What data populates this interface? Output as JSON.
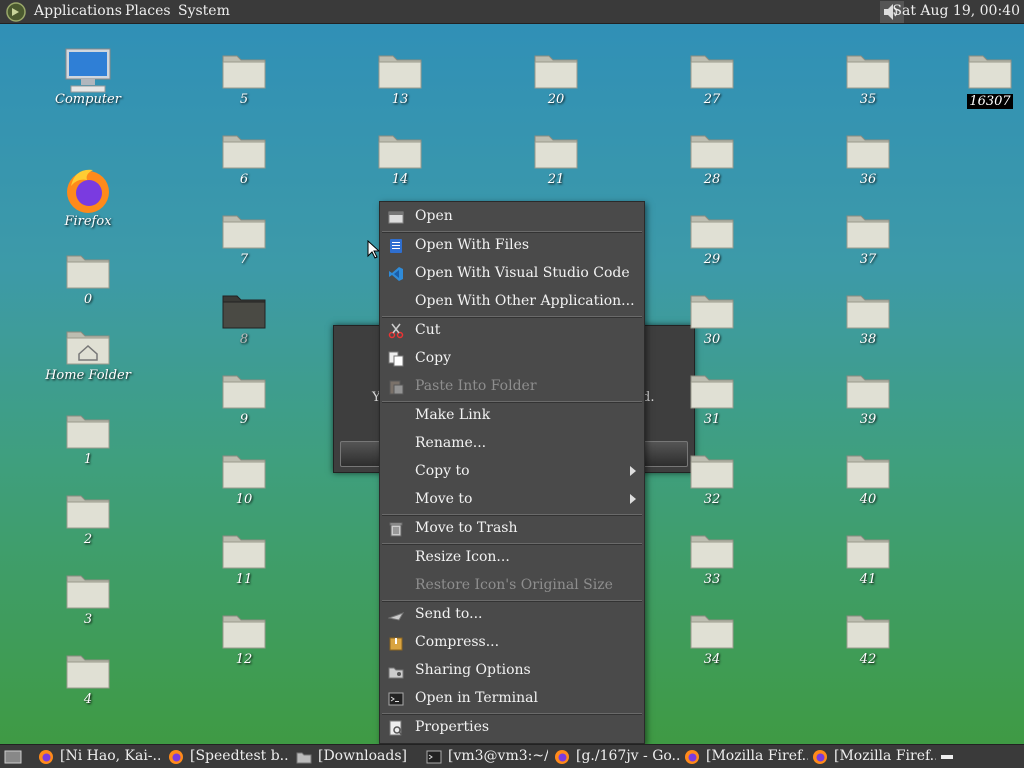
{
  "top_panel": {
    "menus": [
      "Applications",
      "Places",
      "System"
    ],
    "clock": "Sat Aug 19, 00:40"
  },
  "desktop": {
    "computer": "Computer",
    "firefox": "Firefox",
    "home": "Home Folder",
    "folders_col1": [
      "0",
      "1",
      "2",
      "3",
      "4"
    ],
    "folders_col2": [
      "5",
      "6",
      "7",
      "8",
      "9",
      "10",
      "11",
      "12"
    ],
    "folders_col3": [
      "13",
      "14"
    ],
    "folders_col4": [
      "20",
      "21"
    ],
    "folders_col5": [
      "27",
      "28",
      "29",
      "30",
      "31",
      "32",
      "33",
      "34"
    ],
    "folders_col6": [
      "35",
      "36",
      "37",
      "38",
      "39",
      "40",
      "41",
      "42"
    ],
    "last_folder": "16307"
  },
  "dialog": {
    "left_text": "Y",
    "right_text": "d."
  },
  "context_menu": {
    "items": [
      {
        "label": "Open",
        "icon": "open-icon"
      },
      {
        "label": "Open With Files",
        "icon": "files-icon"
      },
      {
        "label": "Open With Visual Studio Code",
        "icon": "vscode-icon"
      },
      {
        "label": "Open With Other Application...",
        "icon": ""
      },
      {
        "label": "Cut",
        "icon": "scissors-icon"
      },
      {
        "label": "Copy",
        "icon": "copy-icon"
      },
      {
        "label": "Paste Into Folder",
        "icon": "paste-icon"
      },
      {
        "label": "Make Link",
        "icon": ""
      },
      {
        "label": "Rename...",
        "icon": ""
      },
      {
        "label": "Copy to",
        "icon": ""
      },
      {
        "label": "Move to",
        "icon": ""
      },
      {
        "label": "Move to Trash",
        "icon": "trash-icon"
      },
      {
        "label": "Resize Icon...",
        "icon": ""
      },
      {
        "label": "Restore Icon's Original Size",
        "icon": ""
      },
      {
        "label": "Send to...",
        "icon": "send-icon"
      },
      {
        "label": "Compress...",
        "icon": "archive-icon"
      },
      {
        "label": "Sharing Options",
        "icon": "share-icon"
      },
      {
        "label": "Open in Terminal",
        "icon": "terminal-icon"
      },
      {
        "label": "Properties",
        "icon": "properties-icon"
      }
    ]
  },
  "taskbar": {
    "tasks": [
      "[Ni Hao, Kai-...",
      "[Speedtest b...",
      "[Downloads]",
      "[vm3@vm3:~/...",
      "[g./167jv - Go...",
      "[Mozilla Firef...",
      "[Mozilla Firef..."
    ]
  },
  "colors": {
    "panel": "#3a3a3a",
    "menu_bg": "#4a4a4a",
    "folder": "#dcdcd0",
    "vscode_blue": "#2f8bd8",
    "firefox_orange": "#ff7a1a"
  }
}
